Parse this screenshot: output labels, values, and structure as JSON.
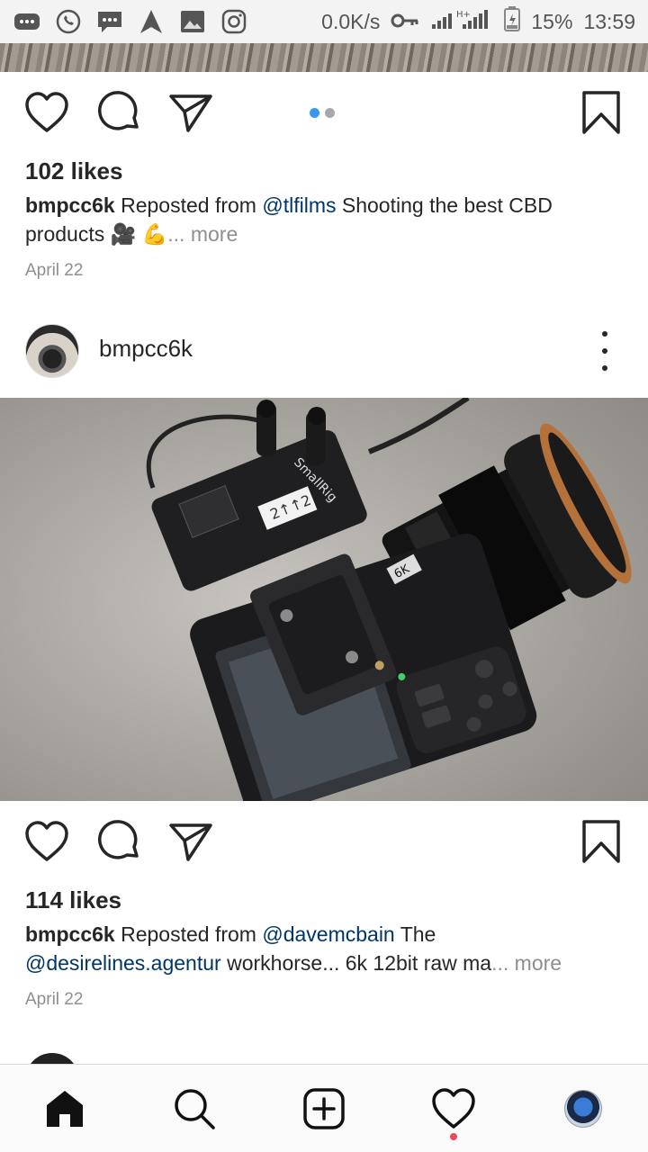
{
  "status_bar": {
    "network_speed": "0.0K/s",
    "signal_label": "H+",
    "battery": "15%",
    "time": "13:59"
  },
  "post1": {
    "likes": "102 likes",
    "caption_user": "bmpcc6k",
    "caption_prefix": " Reposted from ",
    "caption_mention": "@tlfilms",
    "caption_text": " Shooting the best CBD products 🎥 💪",
    "caption_more": "... more",
    "date": "April 22",
    "carousel": {
      "count": 2,
      "active_index": 0
    }
  },
  "post2": {
    "username": "bmpcc6k",
    "likes": "114 likes",
    "caption_user": "bmpcc6k",
    "caption_prefix": " Reposted from ",
    "caption_mention": "@davemcbain",
    "caption_text_1": " The ",
    "caption_mention_2": "@desirelines.agentur",
    "caption_text_2": " workhorse... 6k 12bit raw ma",
    "caption_more": "... more",
    "date": "April 22",
    "photo_labels": {
      "rig_brand": "SmallRig",
      "lens_badge": "6K",
      "tape": "2↑↑2"
    }
  },
  "tab_bar": {
    "items": [
      "home-icon",
      "search-icon",
      "add-post-icon",
      "activity-heart-icon",
      "profile-avatar"
    ],
    "active": "home-icon"
  },
  "colors": {
    "accent": "#3897f0",
    "mention": "#003569",
    "muted": "#8e8e8e",
    "notification": "#ed4956"
  }
}
